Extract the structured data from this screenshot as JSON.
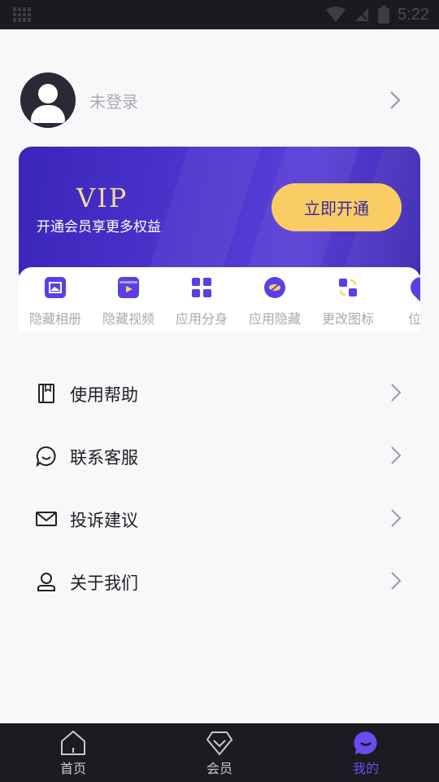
{
  "status_bar": {
    "time": "5:22"
  },
  "profile": {
    "name": "未登录"
  },
  "vip": {
    "logo": "VIP",
    "subtitle": "开通会员享更多权益",
    "button_label": "立即开通"
  },
  "features": [
    {
      "label": "隐藏相册",
      "icon": "hidden-album-icon"
    },
    {
      "label": "隐藏视频",
      "icon": "hidden-video-icon"
    },
    {
      "label": "应用分身",
      "icon": "app-clone-icon"
    },
    {
      "label": "应用隐藏",
      "icon": "app-hide-icon"
    },
    {
      "label": "更改图标",
      "icon": "change-icon-icon"
    },
    {
      "label": "位置",
      "icon": "location-icon"
    }
  ],
  "menu": [
    {
      "label": "使用帮助",
      "icon": "book-icon"
    },
    {
      "label": "联系客服",
      "icon": "chat-icon"
    },
    {
      "label": "投诉建议",
      "icon": "mail-icon"
    },
    {
      "label": "关于我们",
      "icon": "user-icon"
    }
  ],
  "tabs": [
    {
      "label": "首页",
      "icon": "home-icon"
    },
    {
      "label": "会员",
      "icon": "diamond-icon"
    },
    {
      "label": "我的",
      "icon": "mine-icon",
      "active": true
    }
  ],
  "colors": {
    "accent": "#6a4cf0",
    "vip_button": "#f9cd64",
    "vip_card": "#4b33cc"
  }
}
